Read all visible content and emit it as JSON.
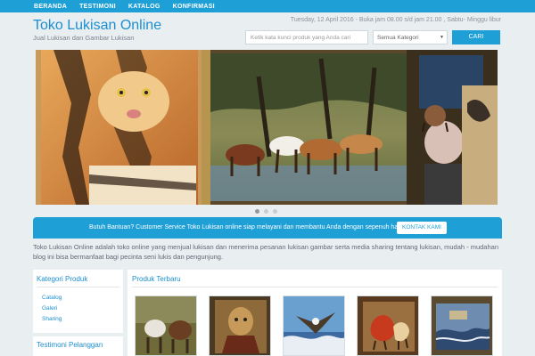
{
  "nav": {
    "items": [
      "BERANDA",
      "TESTIMONI",
      "KATALOG",
      "KONFIRMASI"
    ]
  },
  "header": {
    "title": "Toko Lukisan Online",
    "tagline": "Jual Lukisan dan Gambar Lukisan",
    "date_hours": "Tuesday, 12 April 2016 - Buka jam 08.00 s/d jam 21.00 , Sabtu- Minggu libur"
  },
  "search": {
    "placeholder": "Ketik kata kunci produk yang Anda cari",
    "category": "Semua Kategori",
    "button": "CARI"
  },
  "slider": {
    "active_slide": 1,
    "total_slides": 3
  },
  "help": {
    "text": "Butuh Bantuan? Customer Service Toko Lukisan online siap melayani dan membantu Anda dengan sepenuh hati.",
    "button": "KONTAK KAMI"
  },
  "intro": "Toko Lukisan Online adalah toko online yang menjual lukisan dan menerima pesanan lukisan gambar serta media sharing tentang lukisan, mudah - mudahan blog ini bisa bermanfaat bagi pecinta seni lukis dan pengunjung.",
  "sidebar": {
    "categories_title": "Kategori Produk",
    "categories": [
      "Catalog",
      "Galeri",
      "Sharing"
    ],
    "testimoni_title": "Testimoni Pelanggan"
  },
  "products": {
    "title": "Produk Terbaru"
  },
  "colors": {
    "accent": "#1e9fd6",
    "link": "#1b8fd0",
    "page_bg": "#e9eef1"
  }
}
